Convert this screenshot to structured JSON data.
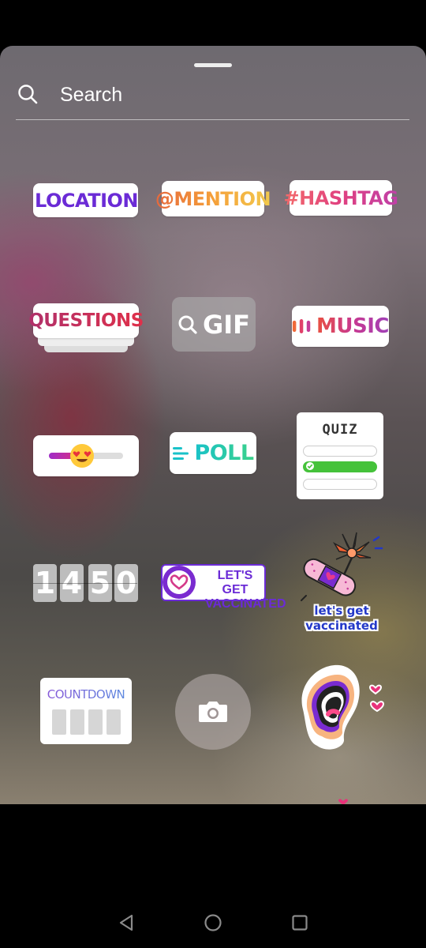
{
  "search": {
    "placeholder": "Search",
    "value": ""
  },
  "stickers": {
    "location": "LOCATION",
    "mention": "@MENTION",
    "hashtag": "#HASHTAG",
    "questions": "QUESTIONS",
    "gif": "GIF",
    "music": "MUSIC",
    "poll": "POLL",
    "quiz": "QUIZ",
    "clock_digits": [
      "1",
      "4",
      "5",
      "0"
    ],
    "vaccinated_line1": "LET'S GET",
    "vaccinated_line2": "VACCINATED",
    "lets_get_line1": "let's get",
    "lets_get_line2": "vaccinated",
    "countdown": "COUNTDOWN"
  },
  "slider": {
    "emoji": "heart-eyes",
    "fill": 0.45
  },
  "colors": {
    "accent_purple": "#6b2bd6",
    "quiz_correct": "#45c23a",
    "poll_teal": "#19c2c9"
  },
  "nav": {
    "back": "back-icon",
    "home": "home-icon",
    "recents": "recents-icon"
  }
}
